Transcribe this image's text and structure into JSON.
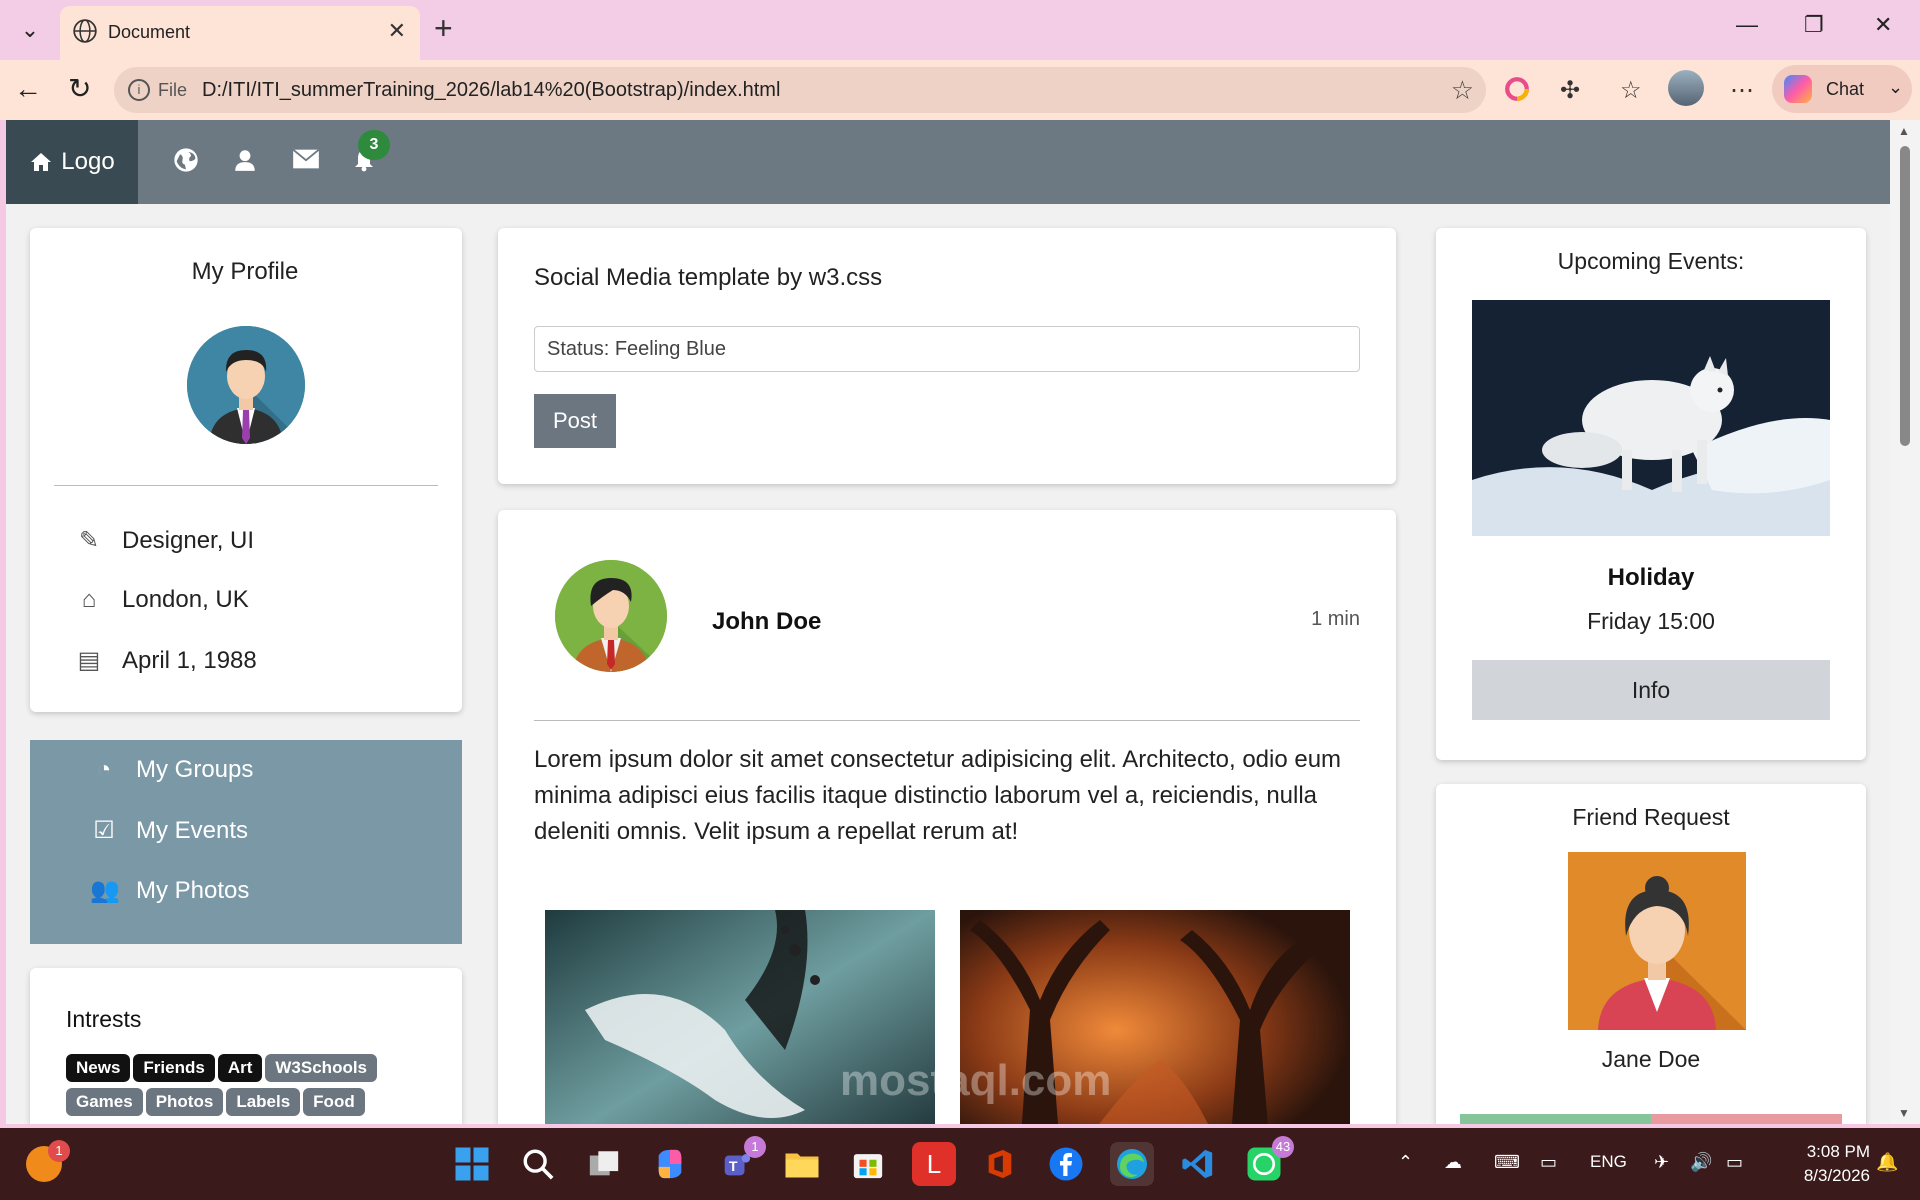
{
  "browser": {
    "tab_title": "Document",
    "file_label": "File",
    "url": "D:/ITI/ITI_summerTraining_2026/lab14%20(Bootstrap)/index.html",
    "chat_label": "Chat"
  },
  "topnav": {
    "logo_label": "Logo",
    "notification_count": "3"
  },
  "profile": {
    "title": "My Profile",
    "job": "Designer, UI",
    "location": "London, UK",
    "birthday": "April 1, 1988"
  },
  "menu": {
    "groups": "My Groups",
    "events": "My Events",
    "photos": "My Photos"
  },
  "interests": {
    "title": "Intrests",
    "tags": [
      "News",
      "Friends",
      "Art",
      "W3Schools",
      "Games",
      "Photos",
      "Labels",
      "Food"
    ]
  },
  "composer": {
    "heading": "Social Media template by w3.css",
    "status_value": "Status: Feeling Blue",
    "post_label": "Post"
  },
  "feed": {
    "author": "John Doe",
    "time": "1 min",
    "text": "Lorem ipsum dolor sit amet consectetur adipisicing elit. Architecto, odio eum minima adipisci eius facilis itaque distinctio laborum vel a, reiciendis, nulla deleniti omnis. Velit ipsum a repellat rerum at!"
  },
  "events": {
    "title": "Upcoming Events:",
    "name": "Holiday",
    "time": "Friday 15:00",
    "info_label": "Info"
  },
  "friend_request": {
    "title": "Friend Request",
    "name": "Jane Doe"
  },
  "taskbar": {
    "badge_left": "1",
    "teams_badge": "1",
    "whatsapp_badge": "43",
    "lang": "ENG",
    "time": "3:08 PM",
    "date": "8/3/2026"
  },
  "watermark": "mostaql.com"
}
